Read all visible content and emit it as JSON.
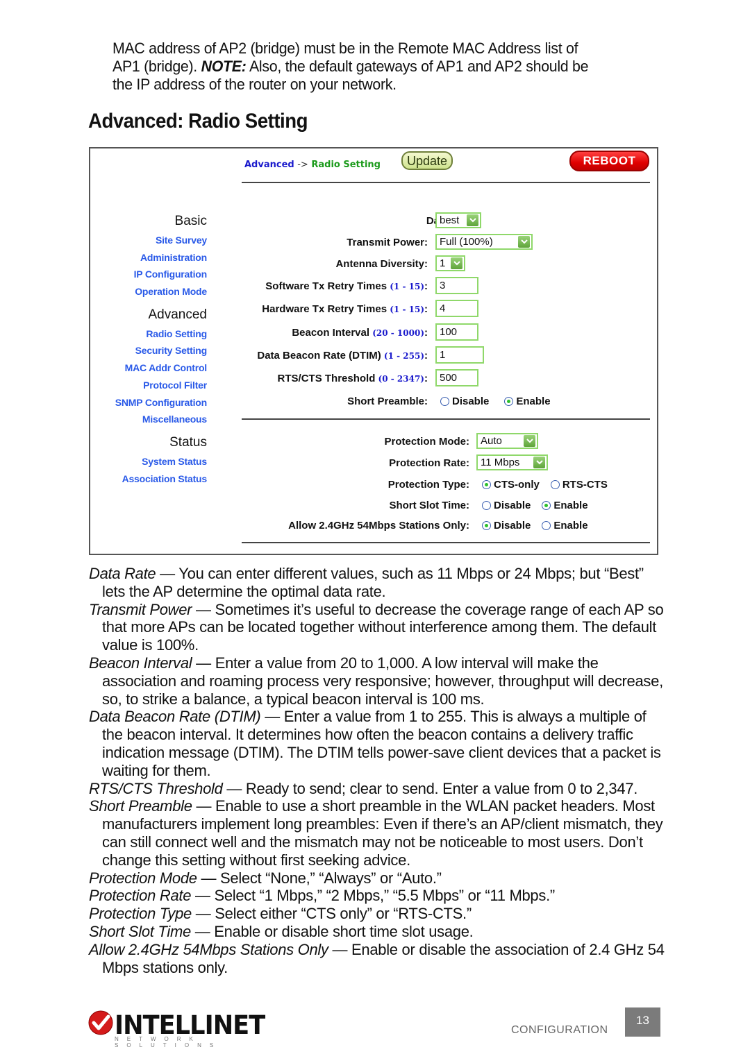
{
  "intro": {
    "line1": "MAC address of AP2 (bridge) must be in the Remote MAC Address list of",
    "line2_a": "AP1 (bridge). ",
    "note_label": "NOTE:",
    "line2_b": " Also, the default gateways of AP1 and AP2 should be",
    "line3": "the IP address of the router on your network."
  },
  "section_title": "Advanced: Radio Setting",
  "ui": {
    "breadcrumb": {
      "parent": "Advanced",
      "separator": "->",
      "current": "Radio Setting"
    },
    "update_label": "Update",
    "reboot_label": "REBOOT",
    "sidebar": [
      {
        "heading": "Basic",
        "links": [
          "Site Survey",
          "Administration",
          "IP Configuration",
          "Operation Mode"
        ]
      },
      {
        "heading": "Advanced",
        "links": [
          "Radio Setting",
          "Security Setting",
          "MAC Addr Control",
          "Protocol Filter",
          "SNMP Configuration",
          "Miscellaneous"
        ]
      },
      {
        "heading": "Status",
        "links": [
          "System Status",
          "Association Status"
        ]
      }
    ],
    "form": {
      "data_rate": {
        "label": "Data Rate:",
        "value": "best"
      },
      "transmit_power": {
        "label": "Transmit Power:",
        "value": "Full (100%)"
      },
      "antenna_diversity": {
        "label": "Antenna Diversity:",
        "value": "1"
      },
      "sw_retry": {
        "label": "Software Tx Retry Times ",
        "range": "(1 - 15)",
        "colon": ":",
        "value": "3"
      },
      "hw_retry": {
        "label": "Hardware Tx Retry Times ",
        "range": "(1 - 15)",
        "colon": ":",
        "value": "4"
      },
      "beacon_interval": {
        "label": "Beacon Interval ",
        "range": "(20 - 1000)",
        "colon": ":",
        "value": "100"
      },
      "dtim": {
        "label": "Data Beacon Rate (DTIM) ",
        "range": "(1 - 255)",
        "colon": ":",
        "value": "1"
      },
      "rts_cts": {
        "label": "RTS/CTS Threshold ",
        "range": "(0 - 2347)",
        "colon": ":",
        "value": "500"
      },
      "short_preamble": {
        "label": "Short Preamble:",
        "options": [
          "Disable",
          "Enable"
        ],
        "selected": "Enable"
      },
      "protection_mode": {
        "label": "Protection Mode:",
        "value": "Auto"
      },
      "protection_rate": {
        "label": "Protection Rate:",
        "value": "11 Mbps"
      },
      "protection_type": {
        "label": "Protection Type:",
        "options": [
          "CTS-only",
          "RTS-CTS"
        ],
        "selected": "CTS-only"
      },
      "short_slot": {
        "label": "Short Slot Time:",
        "options": [
          "Disable",
          "Enable"
        ],
        "selected": "Enable"
      },
      "allow_54": {
        "label": "Allow 2.4GHz 54Mbps Stations Only:",
        "options": [
          "Disable",
          "Enable"
        ],
        "selected": "Disable"
      }
    }
  },
  "descriptions": [
    {
      "term": "Data Rate",
      "text": " — You can enter different values, such as 11 Mbps or 24 Mbps; but “Best” lets the AP determine the optimal data rate."
    },
    {
      "term": "Transmit Power",
      "text": " — Sometimes it’s useful to decrease the coverage range of each AP so that more APs can be located together without interference among them. The default value is 100%."
    },
    {
      "term": "Beacon Interval",
      "text": " — Enter a value from 20 to 1,000. A low interval will make the association and roaming process very responsive; however, throughput will decrease, so, to strike a balance, a typical beacon interval is 100 ms."
    },
    {
      "term": "Data Beacon Rate (DTIM)",
      "text": " — Enter a value from 1 to 255. This is always a multiple of the beacon interval. It determines how often the beacon contains a delivery traffic indication message (DTIM). The DTIM tells power-save client devices that a packet is waiting for them."
    },
    {
      "term": "RTS/CTS Threshold",
      "text": " — Ready to send; clear to send. Enter a value from 0 to 2,347."
    },
    {
      "term": "Short Preamble",
      "text": " — Enable to use a short preamble in the WLAN packet headers. Most manufacturers implement long preambles: Even if there’s an AP/client mismatch, they can still connect well and the mismatch may not be noticeable to most users. Don’t change this setting without first seeking advice."
    },
    {
      "term": "Protection Mode",
      "text": " — Select “None,” “Always” or “Auto.”"
    },
    {
      "term": "Protection Rate",
      "text": " — Select “1 Mbps,” “2 Mbps,” “5.5 Mbps” or “11 Mbps.”"
    },
    {
      "term": "Protection Type",
      "text": " — Select either “CTS only” or “RTS-CTS.”"
    },
    {
      "term": "Short Slot Time",
      "text": " — Enable or disable short time slot usage."
    },
    {
      "term": "Allow 2.4GHz 54Mbps Stations Only",
      "text": " — Enable or disable the association of 2.4 GHz 54 Mbps stations only."
    }
  ],
  "footer": {
    "brand": "INTELLINET",
    "tagline": "NETWORK SOLUTIONS",
    "section": "CONFIGURATION",
    "page_number": "13"
  },
  "colors": {
    "link_blue": "#2a5ae8",
    "breadcrumb_green": "#1a9a1a",
    "input_border": "#8fd86a",
    "reboot_red": "#e00000"
  }
}
